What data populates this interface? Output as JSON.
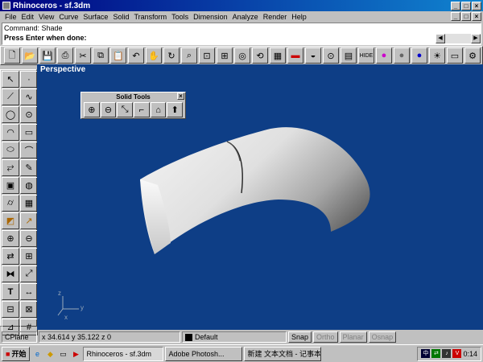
{
  "window": {
    "title": "Rhinoceros - sf.3dm"
  },
  "menu": [
    "File",
    "Edit",
    "View",
    "Curve",
    "Surface",
    "Solid",
    "Transform",
    "Tools",
    "Dimension",
    "Analyze",
    "Render",
    "Help"
  ],
  "command": {
    "history": "Command: Shade",
    "prompt": "Press Enter when done:"
  },
  "viewport": {
    "label": "Perspective",
    "background": "#0e3e86"
  },
  "solid_tools": {
    "title": "Solid Tools"
  },
  "axes": {
    "x": "x",
    "y": "y",
    "z": "z"
  },
  "status": {
    "cplane": "CPlane",
    "coords": "x 34.614  y 35.122  z 0",
    "layer": "Default",
    "snap": "Snap",
    "ortho": "Ortho",
    "planar": "Planar",
    "osnap": "Osnap"
  },
  "taskbar": {
    "start": "开始",
    "tasks": [
      "Rhinoceros - sf.3dm",
      "Adobe Photosh...",
      "新建 文本文档 - 记事本"
    ],
    "clock": "0:14"
  }
}
